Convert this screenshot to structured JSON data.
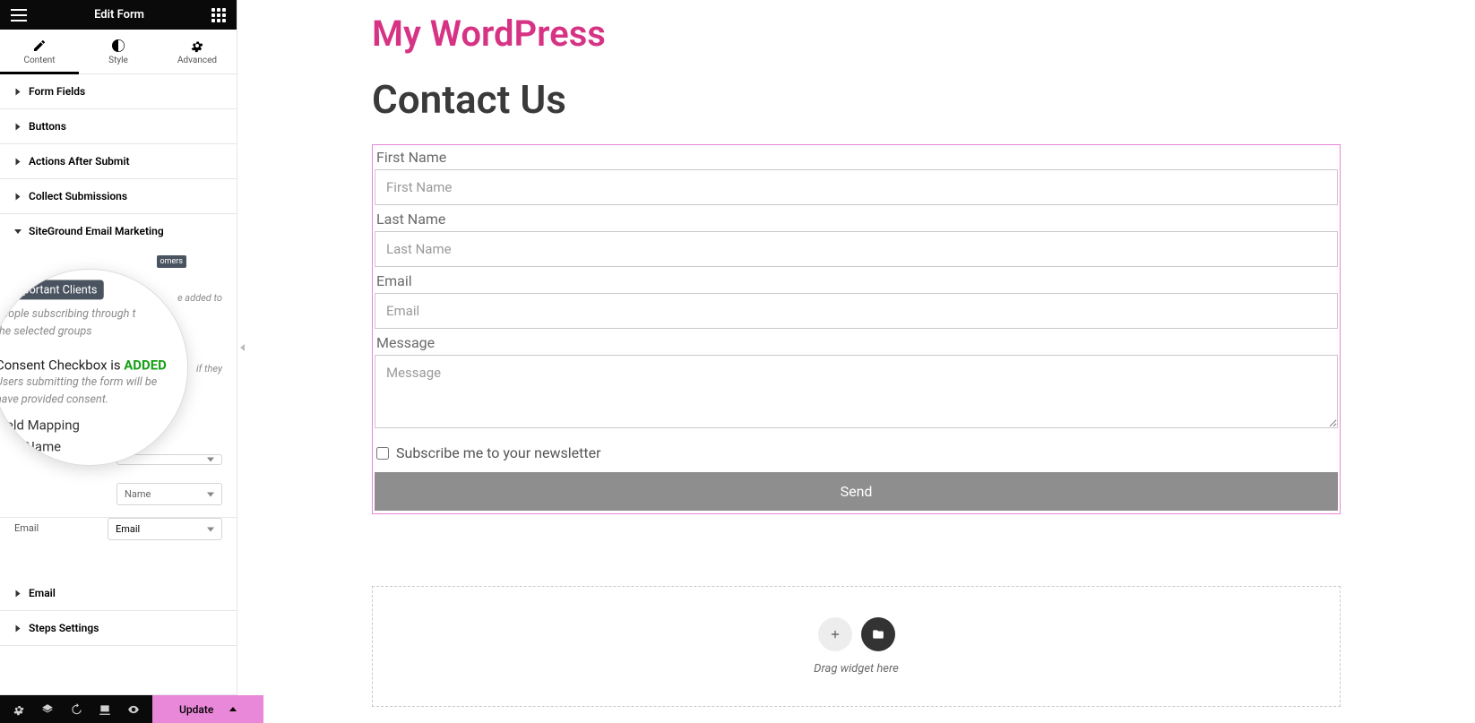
{
  "header": {
    "title": "Edit Form"
  },
  "tabs": {
    "content": "Content",
    "style": "Style",
    "advanced": "Advanced"
  },
  "sections": {
    "form_fields": "Form Fields",
    "buttons": "Buttons",
    "actions_after_submit": "Actions After Submit",
    "collect_submissions": "Collect Submissions",
    "siteground": "SiteGround Email Marketing",
    "email": "Email",
    "steps_settings": "Steps Settings"
  },
  "siteground_panel": {
    "chip": "Important Clients",
    "mini_chip": "omers",
    "hint_tail": "e added to",
    "consent_check_text_tail": "if they"
  },
  "magnifier": {
    "chip": "Important Clients",
    "hint_1": "People subscribing through t",
    "hint_2": "the selected groups",
    "consent_line_pre": "Consent Checkbox is ",
    "consent_line_added": "ADDED",
    "consent_hint_1": "Users submitting the form will be",
    "consent_hint_2": "have provided consent.",
    "field_mapping": "Field Mapping",
    "first_name": "First Name"
  },
  "mapping": {
    "row1_label": "Email",
    "row1_value": "Email",
    "row_name_value": "Name",
    "top_select_blank": ""
  },
  "bottom": {
    "update": "Update"
  },
  "page": {
    "site_title": "My WordPress",
    "title": "Contact Us"
  },
  "form": {
    "first_name_label": "First Name",
    "first_name_ph": "First Name",
    "last_name_label": "Last Name",
    "last_name_ph": "Last Name",
    "email_label": "Email",
    "email_ph": "Email",
    "message_label": "Message",
    "message_ph": "Message",
    "subscribe_label": "Subscribe me to your newsletter",
    "send": "Send"
  },
  "dropzone": {
    "hint": "Drag widget here"
  }
}
